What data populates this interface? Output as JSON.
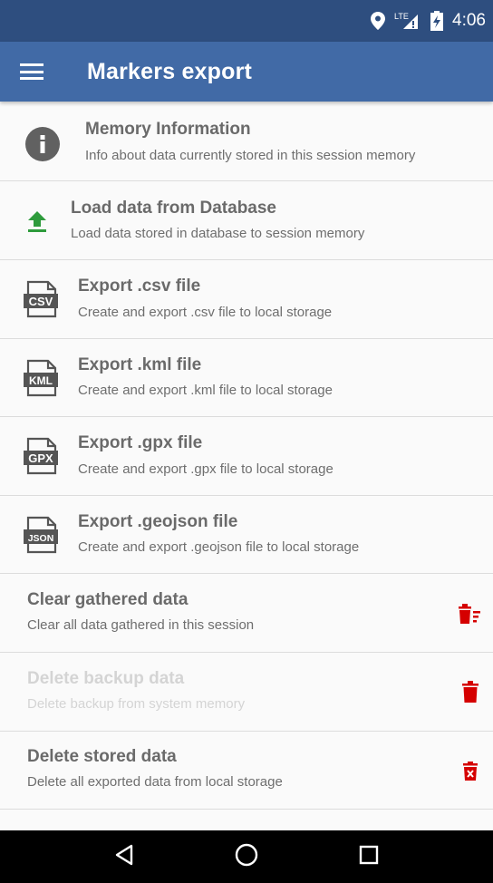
{
  "status": {
    "time": "4:06",
    "network": "LTE"
  },
  "app_bar": {
    "title": "Markers export",
    "menu_icon": "menu-icon"
  },
  "items": [
    {
      "title": "Memory Information",
      "subtitle": "Info about data currently stored in this session memory",
      "icon": "info-icon",
      "enabled": true
    },
    {
      "title": "Load data from Database",
      "subtitle": "Load data stored in database to session memory",
      "icon": "upload-icon",
      "enabled": true
    },
    {
      "title": "Export .csv file",
      "subtitle": "Create and export .csv file to local storage",
      "icon": "csv-file-icon",
      "badge": "CSV",
      "enabled": true
    },
    {
      "title": "Export .kml file",
      "subtitle": "Create and export .kml file to local storage",
      "icon": "kml-file-icon",
      "badge": "KML",
      "enabled": true
    },
    {
      "title": "Export .gpx file",
      "subtitle": "Create and export .gpx file to local storage",
      "icon": "gpx-file-icon",
      "badge": "GPX",
      "enabled": true
    },
    {
      "title": "Export .geojson file",
      "subtitle": "Create and export .geojson file to local storage",
      "icon": "json-file-icon",
      "badge": "JSON",
      "enabled": true
    },
    {
      "title": "Clear gathered data",
      "subtitle": "Clear all data gathered in this session",
      "icon": "delete-sweep-icon",
      "enabled": true
    },
    {
      "title": "Delete backup data",
      "subtitle": "Delete backup from system memory",
      "icon": "delete-icon",
      "enabled": false
    },
    {
      "title": "Delete stored data",
      "subtitle": "Delete all exported data from local storage",
      "icon": "delete-forever-icon",
      "enabled": true
    }
  ],
  "colors": {
    "status_bar": "#2e4e7f",
    "app_bar": "#416aa6",
    "accent_green": "#2e9b3c",
    "danger_red": "#d50000"
  },
  "nav": {
    "back": "back-icon",
    "home": "home-icon",
    "recents": "recents-icon"
  }
}
